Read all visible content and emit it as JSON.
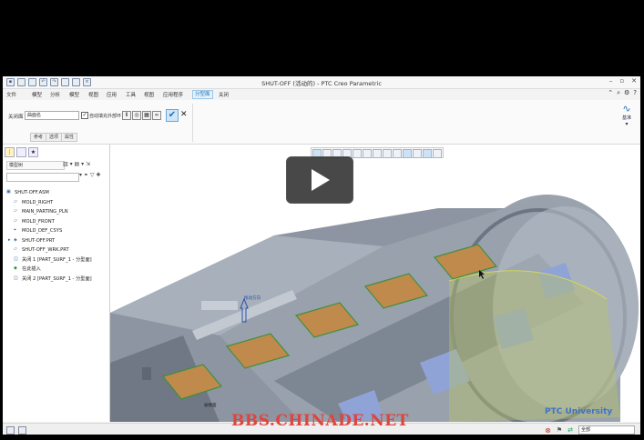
{
  "window": {
    "title": "SHUT-OFF (活动的) - PTC Creo Parametric"
  },
  "menu": {
    "tabs": [
      "文件",
      "模型",
      "分析",
      "模型",
      "视图",
      "应用",
      "工具",
      "视图",
      "应用程序",
      "分型面",
      "关闭"
    ],
    "active_index": 9
  },
  "ribbon": {
    "name_label": "关闭面",
    "name_value": "曲面名",
    "checkbox_label": "自动填充外部环",
    "subtabs": [
      "参考",
      "选项",
      "属性"
    ],
    "right_label": "基准"
  },
  "panel": {
    "tree_dropdown": "模型树",
    "items": [
      {
        "label": "SHUT-OFF.ASM",
        "icon": "assembly-icon"
      },
      {
        "label": "MOLD_RIGHT",
        "icon": "datum-plane-icon"
      },
      {
        "label": "MAIN_PARTING_PLN",
        "icon": "datum-plane-icon"
      },
      {
        "label": "MOLD_FRONT",
        "icon": "datum-plane-icon"
      },
      {
        "label": "MOLD_DEF_CSYS",
        "icon": "csys-icon"
      },
      {
        "label": "SHUT-OFF.PRT",
        "icon": "part-icon"
      },
      {
        "label": "SHUT-OFF_WRK.PRT",
        "icon": "part-icon"
      },
      {
        "label": "关闭 1 [PART_SURF_1 - 分型面]",
        "icon": "surface-icon"
      },
      {
        "label": "在此插入",
        "icon": "insert-here-icon"
      },
      {
        "label": "关闭 2 [PART_SURF_1 - 分型面]",
        "icon": "surface-icon"
      }
    ]
  },
  "viewport": {
    "arrow_label": "拖动方向",
    "surface_label": "拔模面"
  },
  "status": {
    "filter_value": "全部"
  },
  "overlay": {
    "watermark": "BBS.CHINADE.NET",
    "brand": "PTC University"
  },
  "colors": {
    "accent": "#1c6fb8",
    "shutoff_surface": "#c08a4c",
    "model_gray": "#8d97a4"
  }
}
